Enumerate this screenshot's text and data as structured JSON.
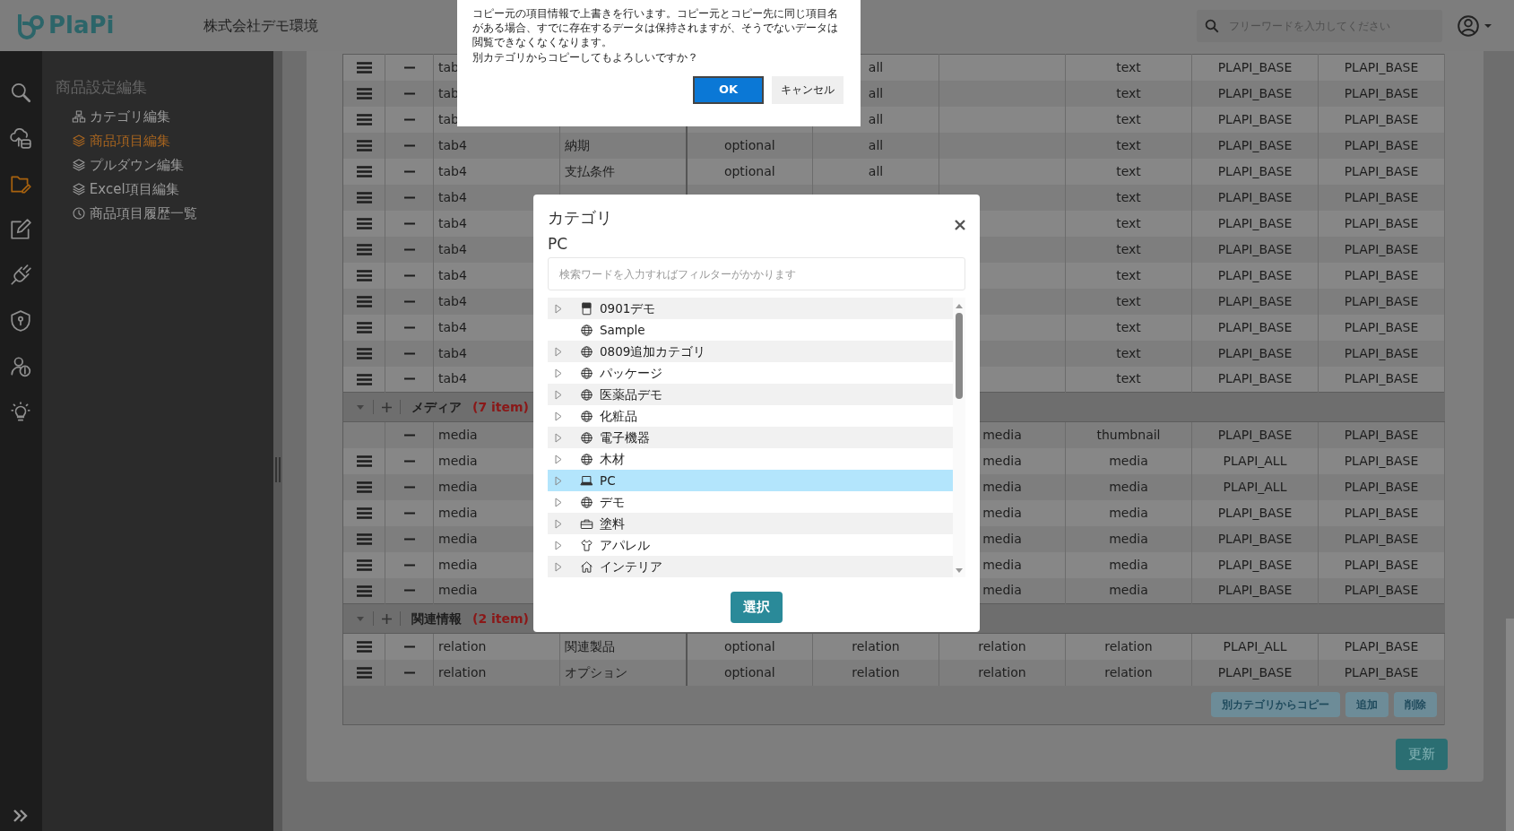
{
  "header": {
    "logo": "PlaPi",
    "company": "株式会社デモ環境",
    "search": {
      "placeholder": "フリーワードを入力してください"
    }
  },
  "rail": [
    {
      "kind": "search",
      "selected": false
    },
    {
      "kind": "cloud",
      "selected": false
    },
    {
      "kind": "folder",
      "selected": true
    },
    {
      "kind": "pencil",
      "selected": false
    },
    {
      "kind": "plug",
      "selected": false
    },
    {
      "kind": "shield",
      "selected": false
    },
    {
      "kind": "people",
      "selected": false
    },
    {
      "kind": "bulb",
      "selected": false
    }
  ],
  "sidebar": {
    "title": "商品設定編集",
    "items": [
      {
        "label": "カテゴリ編集",
        "kind": "sitemap",
        "selected": false
      },
      {
        "label": "商品項目編集",
        "kind": "layers",
        "selected": true
      },
      {
        "label": "プルダウン編集",
        "kind": "layers",
        "selected": false
      },
      {
        "label": "Excel項目編集",
        "kind": "layers",
        "selected": false
      },
      {
        "label": "商品項目履歴一覧",
        "kind": "clock",
        "selected": false
      }
    ]
  },
  "table": {
    "sections": [
      {
        "rows": [
          {
            "draggable": true,
            "cells": [
              "tab",
              null,
              null,
              "all",
              null,
              "text",
              "PLAPI_BASE",
              "PLAPI_BASE"
            ]
          },
          {
            "draggable": true,
            "cells": [
              "tab",
              null,
              null,
              "all",
              null,
              "text",
              "PLAPI_BASE",
              "PLAPI_BASE"
            ]
          },
          {
            "draggable": true,
            "cells": [
              "tab",
              null,
              null,
              "all",
              null,
              "text",
              "PLAPI_BASE",
              "PLAPI_BASE"
            ]
          },
          {
            "draggable": true,
            "cells": [
              "tab4",
              "納期",
              "optional",
              "all",
              null,
              "text",
              "PLAPI_BASE",
              "PLAPI_BASE"
            ]
          },
          {
            "draggable": true,
            "cells": [
              "tab4",
              "支払条件",
              "optional",
              "all",
              null,
              "text",
              "PLAPI_BASE",
              "PLAPI_BASE"
            ]
          },
          {
            "draggable": true,
            "cells": [
              "tab4",
              null,
              null,
              null,
              null,
              "text",
              "PLAPI_BASE",
              "PLAPI_BASE"
            ]
          },
          {
            "draggable": true,
            "cells": [
              "tab4",
              null,
              null,
              null,
              null,
              "text",
              "PLAPI_BASE",
              "PLAPI_BASE"
            ]
          },
          {
            "draggable": true,
            "cells": [
              "tab4",
              null,
              null,
              null,
              null,
              "text",
              "PLAPI_BASE",
              "PLAPI_BASE"
            ]
          },
          {
            "draggable": true,
            "cells": [
              "tab4",
              null,
              null,
              null,
              null,
              "text",
              "PLAPI_BASE",
              "PLAPI_BASE"
            ]
          },
          {
            "draggable": true,
            "cells": [
              "tab4",
              null,
              null,
              null,
              null,
              "text",
              "PLAPI_BASE",
              "PLAPI_BASE"
            ]
          },
          {
            "draggable": true,
            "cells": [
              "tab4",
              null,
              null,
              null,
              null,
              "text",
              "PLAPI_BASE",
              "PLAPI_BASE"
            ]
          },
          {
            "draggable": true,
            "cells": [
              "tab4",
              null,
              null,
              null,
              null,
              "text",
              "PLAPI_BASE",
              "PLAPI_BASE"
            ]
          },
          {
            "draggable": true,
            "cells": [
              "tab4",
              null,
              null,
              null,
              null,
              "text",
              "PLAPI_BASE",
              "PLAPI_BASE"
            ]
          }
        ]
      },
      {
        "title": "メディア",
        "count": "(7 item)",
        "expanded": true,
        "rows": [
          {
            "draggable": false,
            "cells": [
              "media",
              null,
              null,
              null,
              "media",
              "thumbnail",
              "PLAPI_BASE",
              "PLAPI_BASE"
            ]
          },
          {
            "draggable": true,
            "cells": [
              "media",
              null,
              null,
              null,
              "media",
              "media",
              "PLAPI_ALL",
              "PLAPI_BASE"
            ]
          },
          {
            "draggable": true,
            "cells": [
              "media",
              null,
              null,
              null,
              "media",
              "media",
              "PLAPI_ALL",
              "PLAPI_BASE"
            ]
          },
          {
            "draggable": true,
            "cells": [
              "media",
              null,
              null,
              null,
              "media",
              "media",
              "PLAPI_BASE",
              "PLAPI_BASE"
            ]
          },
          {
            "draggable": true,
            "cells": [
              "media",
              null,
              null,
              null,
              "media",
              "media",
              "PLAPI_BASE",
              "PLAPI_BASE"
            ]
          },
          {
            "draggable": true,
            "cells": [
              "media",
              null,
              null,
              null,
              "media",
              "media",
              "PLAPI_BASE",
              "PLAPI_BASE"
            ]
          },
          {
            "draggable": true,
            "cells": [
              "media",
              null,
              null,
              null,
              "media",
              "media",
              "PLAPI_BASE",
              "PLAPI_BASE"
            ]
          }
        ]
      },
      {
        "title": "関連情報",
        "count": "(2 item)",
        "expanded": true,
        "rows": [
          {
            "draggable": true,
            "cells": [
              "relation",
              "関連製品",
              "optional",
              "relation",
              "relation",
              "relation",
              "PLAPI_ALL",
              "PLAPI_BASE"
            ]
          },
          {
            "draggable": true,
            "cells": [
              "relation",
              "オプション",
              "optional",
              "relation",
              "relation",
              "relation",
              "PLAPI_BASE",
              "PLAPI_BASE"
            ]
          }
        ]
      }
    ],
    "buttons": [
      "別カテゴリからコピー",
      "追加",
      "削除"
    ]
  },
  "update_button": "更新",
  "confirm": {
    "message": "コピー元の項目情報で上書きを行います。コピー元とコピー先に同じ項目名がある場合、すでに存在するデータは保持されますが、そうでないデータは閲覧できなくなくなります。",
    "question": "別カテゴリからコピーしてもよろしいですか？",
    "buttons": [
      {
        "label": "OK",
        "primary": true
      },
      {
        "label": "キャンセル",
        "primary": false
      }
    ]
  },
  "modal": {
    "title": "カテゴリ",
    "subtitle": "PC",
    "search": {
      "placeholder": "検索ワードを入力すればフィルターがかかります"
    },
    "tree": [
      {
        "label": "0901デモ",
        "kind": "calculator",
        "expandable": true,
        "selected": false
      },
      {
        "label": "Sample",
        "kind": "globe",
        "expandable": false,
        "selected": false
      },
      {
        "label": "0809追加カテゴリ",
        "kind": "globe",
        "expandable": true,
        "selected": false
      },
      {
        "label": "パッケージ",
        "kind": "globe",
        "expandable": true,
        "selected": false
      },
      {
        "label": "医薬品デモ",
        "kind": "globe",
        "expandable": true,
        "selected": false
      },
      {
        "label": "化粧品",
        "kind": "globe",
        "expandable": true,
        "selected": false
      },
      {
        "label": "電子機器",
        "kind": "globe",
        "expandable": true,
        "selected": false
      },
      {
        "label": "木材",
        "kind": "globe",
        "expandable": true,
        "selected": false
      },
      {
        "label": "PC",
        "kind": "laptop",
        "expandable": true,
        "selected": true
      },
      {
        "label": "デモ",
        "kind": "globe",
        "expandable": true,
        "selected": false
      },
      {
        "label": "塗料",
        "kind": "toolbox",
        "expandable": true,
        "selected": false
      },
      {
        "label": "アパレル",
        "kind": "shirt",
        "expandable": true,
        "selected": false
      },
      {
        "label": "インテリア",
        "kind": "house",
        "expandable": true,
        "selected": false
      }
    ],
    "button": "選択"
  }
}
